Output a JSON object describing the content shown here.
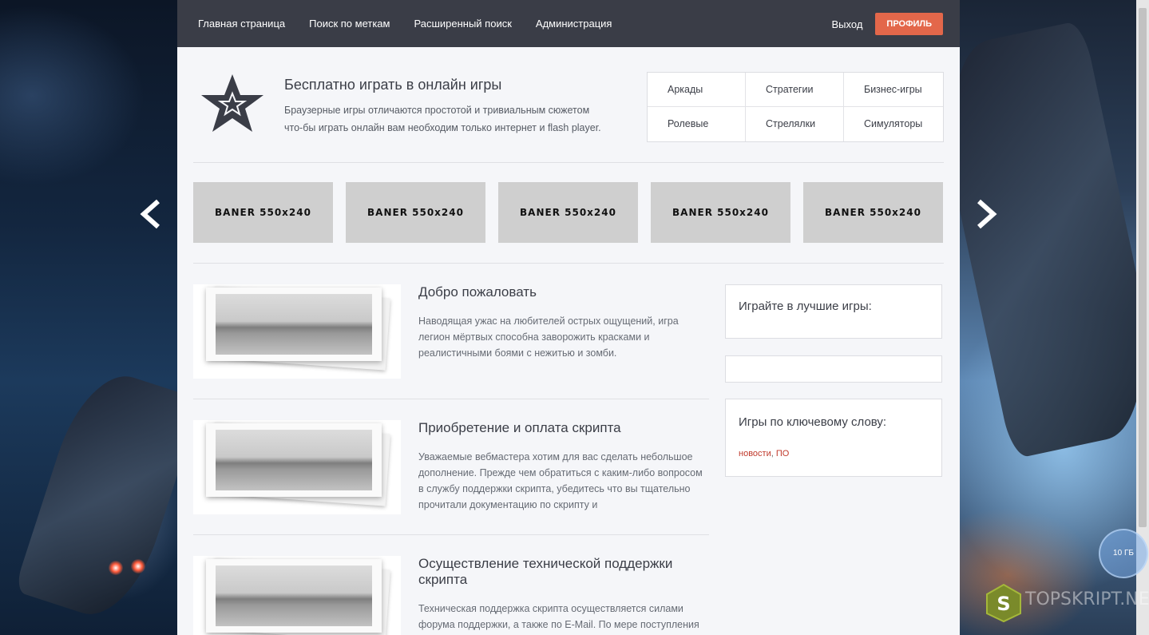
{
  "nav": {
    "links": [
      "Главная страница",
      "Поиск по меткам",
      "Расширенный поиск",
      "Администрация"
    ],
    "logout": "Выход",
    "profile": "ПРОФИЛЬ"
  },
  "hero": {
    "title": "Бесплатно играть в онлайн игры",
    "text_line1": "Браузерные игры отличаются простотой и тривиальным сюжетом",
    "text_line2": "что-бы играть онлайн вам необходим только интернет и flash player."
  },
  "categories": [
    "Аркады",
    "Стратегии",
    "Бизнес-игры",
    "Ролевые",
    "Стрелялки",
    "Симуляторы"
  ],
  "banners": [
    "BANER 550x240",
    "BANER 550x240",
    "BANER 550x240",
    "BANER 550x240",
    "BANER 550x240"
  ],
  "news": [
    {
      "title": "Добро пожаловать",
      "text": "Наводящая ужас на любителей острых ощущений, игра легион мёртвых способна заворожить красками и реалистичными боями с нежитью и зомби."
    },
    {
      "title": "Приобретение и оплата скрипта",
      "text": "Уважаемые вебмастера хотим для вас сделать небольшое дополнение. Прежде чем обратиться с каким-либо вопросом в службу поддержки скрипта, убедитесь что вы тщательно прочитали документацию по скрипту и"
    },
    {
      "title": "Осуществление технической поддержки скрипта",
      "text": "Техническая поддержка скрипта осуществляется силами форума поддержки, а также по E-Mail. По мере поступления"
    }
  ],
  "sidebar": {
    "best_games": "Играйте в лучшие игры:",
    "keyword_games": "Игры по ключевому слову:",
    "tags": [
      "новости",
      "ПО"
    ],
    "tag_sep": ","
  },
  "watermark": {
    "letter": "S",
    "text": "TOPSKRIPT.NET",
    "badge": "10 ГБ"
  },
  "colors": {
    "nav_bg": "#3a3d47",
    "accent": "#e3674a",
    "page_bg": "#f5f6f9",
    "tag_color": "#c0392b"
  }
}
